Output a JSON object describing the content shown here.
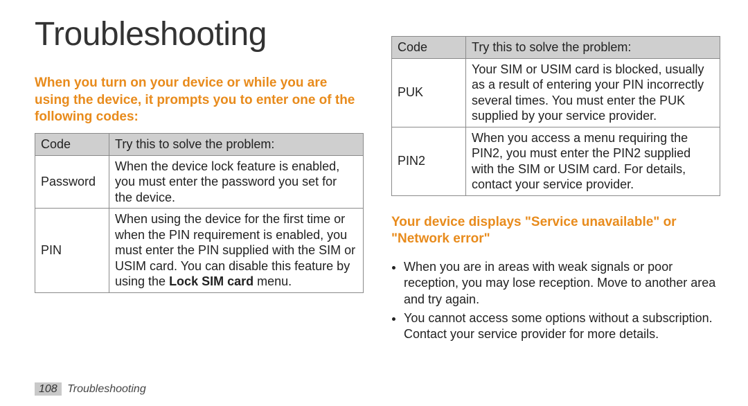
{
  "title": "Troubleshooting",
  "left": {
    "subhead": "When you turn on your device or while you are using the device, it prompts you to enter one of the following codes:",
    "table_headers": {
      "code": "Code",
      "solve": "Try this to solve the problem:"
    },
    "rows": [
      {
        "code": "Password",
        "text": "When the device lock feature is enabled, you must enter the password you set for the device."
      },
      {
        "code": "PIN",
        "text_pre": "When using the device for the first time or when the PIN requirement is enabled, you must enter the PIN supplied with the SIM or USIM card. You can disable this feature by using the ",
        "text_bold": "Lock SIM card",
        "text_post": " menu."
      }
    ]
  },
  "right": {
    "table_headers": {
      "code": "Code",
      "solve": "Try this to solve the problem:"
    },
    "rows": [
      {
        "code": "PUK",
        "text": "Your SIM or USIM card is blocked, usually as a result of entering your PIN incorrectly several times. You must enter the PUK supplied by your service provider."
      },
      {
        "code": "PIN2",
        "text": "When you access a menu requiring the PIN2, you must enter the PIN2 supplied with the SIM or USIM card. For details, contact your service provider."
      }
    ],
    "subhead": "Your device displays \"Service unavailable\" or \"Network error\"",
    "bullets": [
      "When you are in areas with weak signals or poor reception, you may lose reception. Move to another area and try again.",
      "You cannot access some options without a subscription. Contact your service provider for more details."
    ]
  },
  "footer": {
    "page_num": "108",
    "section": "Troubleshooting"
  }
}
